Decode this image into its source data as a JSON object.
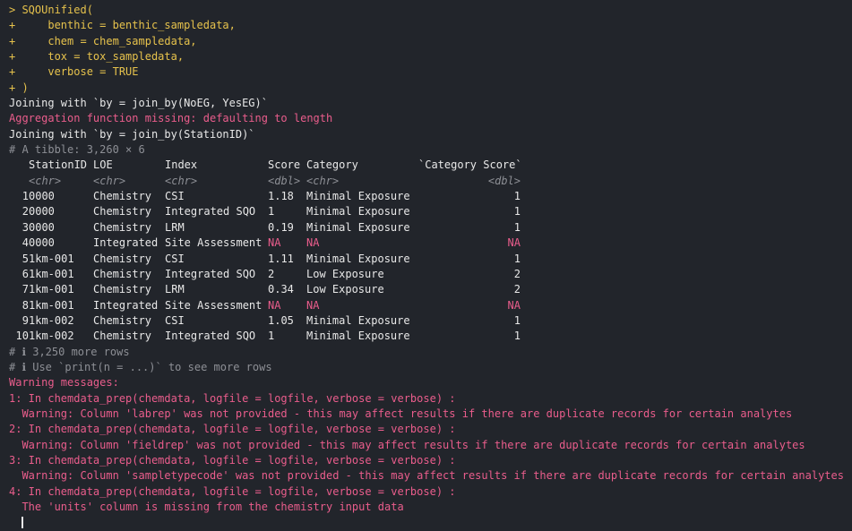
{
  "console": {
    "command": [
      "> SQOUnified(",
      "+     benthic = benthic_sampledata,",
      "+     chem = chem_sampledata,",
      "+     tox = tox_sampledata,",
      "+     verbose = TRUE",
      "+ )"
    ],
    "joining_1": "Joining with `by = join_by(NoEG, YesEG)`",
    "aggregation_msg": "Aggregation function missing: defaulting to length",
    "joining_2": "Joining with `by = join_by(StationID)`",
    "tibble_info": "# A tibble: 3,260 × 6",
    "table": {
      "headers": [
        "StationID",
        "LOE",
        "Index",
        "Score",
        "Category",
        "`Category Score`"
      ],
      "types": [
        "<chr>",
        "<chr>",
        "<chr>",
        "<dbl>",
        "<chr>",
        "<dbl>"
      ],
      "rows": [
        {
          "n": "1",
          "StationID": "0000",
          "LOE": "Chemistry",
          "Index": "CSI",
          "Score": "1.18",
          "Category": "Minimal Exposure",
          "CategoryScore": "1"
        },
        {
          "n": "2",
          "StationID": "0000",
          "LOE": "Chemistry",
          "Index": "Integrated SQO",
          "Score": "1",
          "Category": "Minimal Exposure",
          "CategoryScore": "1"
        },
        {
          "n": "3",
          "StationID": "0000",
          "LOE": "Chemistry",
          "Index": "LRM",
          "Score": "0.19",
          "Category": "Minimal Exposure",
          "CategoryScore": "1"
        },
        {
          "n": "4",
          "StationID": "0000",
          "LOE": "Integrated",
          "Index": "Site Assessment",
          "Score": "NA",
          "Category": "NA",
          "CategoryScore": "NA"
        },
        {
          "n": "5",
          "StationID": "1km-001",
          "LOE": "Chemistry",
          "Index": "CSI",
          "Score": "1.11",
          "Category": "Minimal Exposure",
          "CategoryScore": "1"
        },
        {
          "n": "6",
          "StationID": "1km-001",
          "LOE": "Chemistry",
          "Index": "Integrated SQO",
          "Score": "2",
          "Category": "Low Exposure",
          "CategoryScore": "2"
        },
        {
          "n": "7",
          "StationID": "1km-001",
          "LOE": "Chemistry",
          "Index": "LRM",
          "Score": "0.34",
          "Category": "Low Exposure",
          "CategoryScore": "2"
        },
        {
          "n": "8",
          "StationID": "1km-001",
          "LOE": "Integrated",
          "Index": "Site Assessment",
          "Score": "NA",
          "Category": "NA",
          "CategoryScore": "NA"
        },
        {
          "n": "9",
          "StationID": "1km-002",
          "LOE": "Chemistry",
          "Index": "CSI",
          "Score": "1.05",
          "Category": "Minimal Exposure",
          "CategoryScore": "1"
        },
        {
          "n": "10",
          "StationID": "1km-002",
          "LOE": "Chemistry",
          "Index": "Integrated SQO",
          "Score": "1",
          "Category": "Minimal Exposure",
          "CategoryScore": "1"
        }
      ]
    },
    "more_rows": "# ℹ 3,250 more rows",
    "print_hint": "# ℹ Use `print(n = ...)` to see more rows",
    "warning_header": "Warning messages:",
    "warnings": [
      {
        "call": "1: In chemdata_prep(chemdata, logfile = logfile, verbose = verbose) :",
        "message": "  Warning: Column 'labrep' was not provided - this may affect results if there are duplicate records for certain analytes"
      },
      {
        "call": "2: In chemdata_prep(chemdata, logfile = logfile, verbose = verbose) :",
        "message": "  Warning: Column 'fieldrep' was not provided - this may affect results if there are duplicate records for certain analytes"
      },
      {
        "call": "3: In chemdata_prep(chemdata, logfile = logfile, verbose = verbose) :",
        "message": "  Warning: Column 'sampletypecode' was not provided - this may affect results if there are duplicate records for certain analytes"
      },
      {
        "call": "4: In chemdata_prep(chemdata, logfile = logfile, verbose = verbose) :",
        "message": "  The 'units' column is missing from the chemistry input data"
      }
    ]
  },
  "colors": {
    "background": "#22252b",
    "prompt": "#e6c24c",
    "output": "#e8e8e8",
    "error": "#ea5d8c",
    "meta": "#8d8f95"
  }
}
